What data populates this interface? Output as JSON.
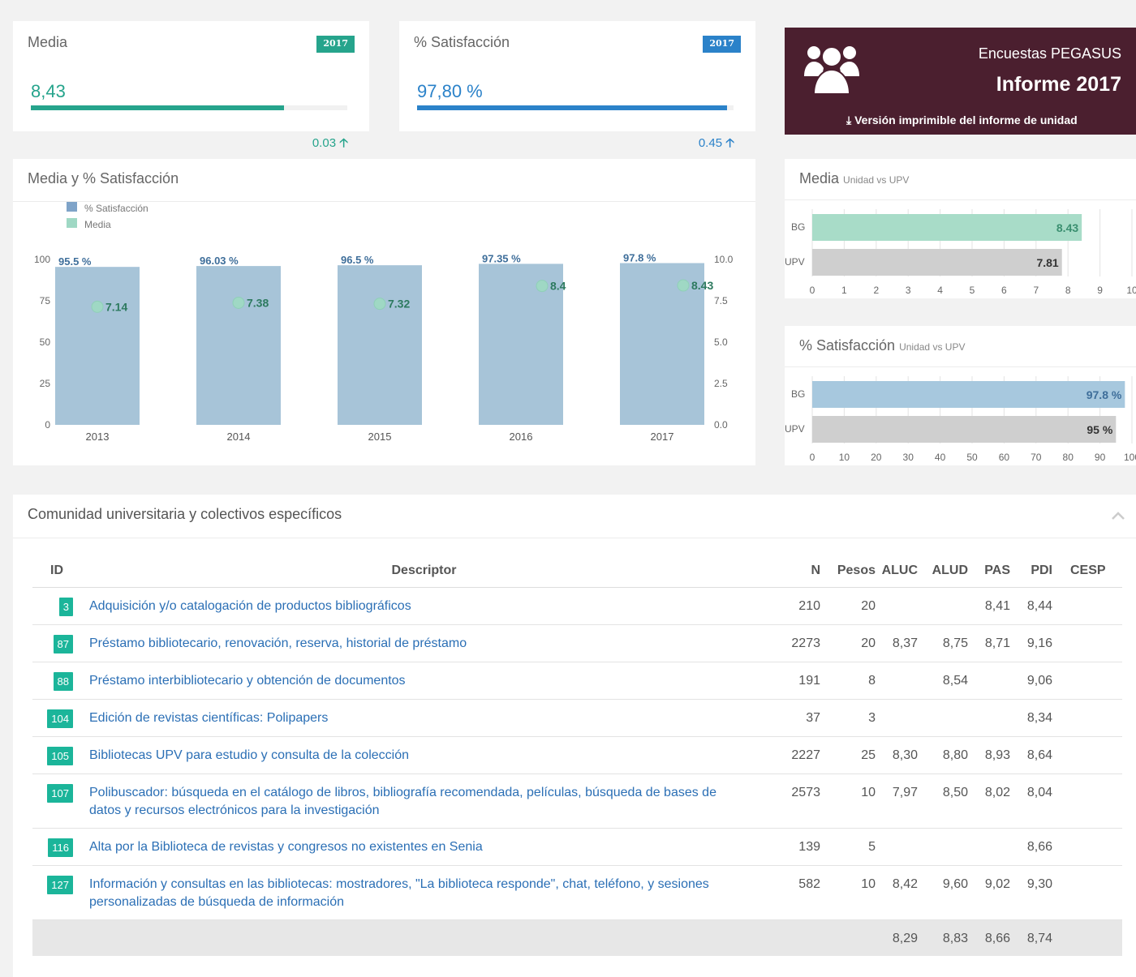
{
  "kpi_media": {
    "title": "Media",
    "year": "2017",
    "value": "8,43",
    "delta": "0.03",
    "fill": 0.8,
    "color": "#26a48c"
  },
  "kpi_satisfaccion": {
    "title": "% Satisfacción",
    "year": "2017",
    "value": "97,80 %",
    "delta": "0.45",
    "fill": 0.98,
    "color": "#2b82c9"
  },
  "promo": {
    "subtitle": "Encuestas PEGASUS",
    "title": "Informe 2017",
    "link": "Versión imprimible del informe de unidad"
  },
  "main_chart": {
    "title": "Media y % Satisfacción"
  },
  "media_chart": {
    "title": "Media",
    "subtitle": "Unidad vs UPV"
  },
  "sat_chart": {
    "title": "% Satisfacción",
    "subtitle": "Unidad vs UPV"
  },
  "chart_data": [
    {
      "type": "bar",
      "title": "Media y % Satisfacción",
      "categories": [
        "2013",
        "2014",
        "2015",
        "2016",
        "2017"
      ],
      "series": [
        {
          "name": "% Satisfacción",
          "kind": "bar",
          "axis": "left",
          "values": [
            95.5,
            96.03,
            96.5,
            97.35,
            97.8
          ],
          "labels": [
            "95.5 %",
            "96.03 %",
            "96.5 %",
            "97.35 %",
            "97.8 %"
          ],
          "color": "#a7c4d8"
        },
        {
          "name": "Media",
          "kind": "point",
          "axis": "right",
          "values": [
            7.14,
            7.38,
            7.32,
            8.4,
            8.43
          ],
          "labels": [
            "7.14",
            "7.38",
            "7.32",
            "8.4",
            "8.43"
          ],
          "color": "#9fd8c4"
        }
      ],
      "y_left": {
        "ticks": [
          "100",
          "75",
          "50",
          "25",
          "0"
        ],
        "lim": [
          0,
          100
        ]
      },
      "y_right": {
        "ticks": [
          "10.0",
          "7.5",
          "5.0",
          "2.5",
          "0.0"
        ],
        "lim": [
          0,
          10
        ]
      },
      "legend": "top-left",
      "grid": false
    },
    {
      "type": "bar",
      "orientation": "horizontal",
      "title": "Media",
      "subtitle": "Unidad vs UPV",
      "categories": [
        "BG",
        "UPV"
      ],
      "values": [
        8.43,
        7.81
      ],
      "labels": [
        "8.43",
        "7.81"
      ],
      "colors": [
        "#a8dcc8",
        "#cfcfcf"
      ],
      "xticks": [
        "0",
        "1",
        "2",
        "3",
        "4",
        "5",
        "6",
        "7",
        "8",
        "9",
        "10"
      ],
      "xlim": [
        0,
        10
      ],
      "grid": true
    },
    {
      "type": "bar",
      "orientation": "horizontal",
      "title": "% Satisfacción",
      "subtitle": "Unidad vs UPV",
      "categories": [
        "BG",
        "UPV"
      ],
      "values": [
        97.8,
        95
      ],
      "labels": [
        "97.8 %",
        "95 %"
      ],
      "colors": [
        "#a7c8de",
        "#cfcfcf"
      ],
      "xticks": [
        "0",
        "10",
        "20",
        "30",
        "40",
        "50",
        "60",
        "70",
        "80",
        "90",
        "100"
      ],
      "xlim": [
        0,
        100
      ],
      "grid": true
    }
  ],
  "community": {
    "title": "Comunidad universitaria y colectivos específicos",
    "headers": [
      "ID",
      "Descriptor",
      "N",
      "Pesos",
      "ALUC",
      "ALUD",
      "PAS",
      "PDI",
      "CESP"
    ],
    "rows": [
      [
        "3",
        "Adquisición y/o catalogación de productos bibliográficos",
        "210",
        "20",
        "",
        "",
        "8,41",
        "8,44",
        ""
      ],
      [
        "87",
        "Préstamo bibliotecario, renovación, reserva, historial de préstamo",
        "2273",
        "20",
        "8,37",
        "8,75",
        "8,71",
        "9,16",
        ""
      ],
      [
        "88",
        "Préstamo interbibliotecario y obtención de documentos",
        "191",
        "8",
        "",
        "8,54",
        "",
        "9,06",
        ""
      ],
      [
        "104",
        "Edición de revistas científicas: Polipapers",
        "37",
        "3",
        "",
        "",
        "",
        "8,34",
        ""
      ],
      [
        "105",
        "Bibliotecas UPV para estudio y consulta de la colección",
        "2227",
        "25",
        "8,30",
        "8,80",
        "8,93",
        "8,64",
        ""
      ],
      [
        "107",
        "Polibuscador: búsqueda en el catálogo de libros, bibliografía recomendada, películas, búsqueda de bases de datos y recursos electrónicos para la investigación",
        "2573",
        "10",
        "7,97",
        "8,50",
        "8,02",
        "8,04",
        ""
      ],
      [
        "116",
        "Alta por la Biblioteca de revistas y congresos no existentes en Senia",
        "139",
        "5",
        "",
        "",
        "",
        "8,66",
        ""
      ],
      [
        "127",
        "Información y consultas en las bibliotecas: mostradores, \"La biblioteca responde\", chat, teléfono, y sesiones personalizadas de búsqueda de información",
        "582",
        "10",
        "8,42",
        "9,60",
        "9,02",
        "9,30",
        ""
      ]
    ],
    "totals": [
      "",
      "",
      "",
      "",
      "8,29",
      "8,83",
      "8,66",
      "8,74",
      ""
    ]
  }
}
